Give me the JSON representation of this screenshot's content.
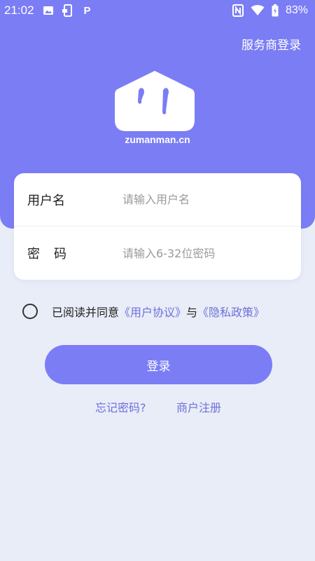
{
  "status_bar": {
    "time": "21:02",
    "battery_percent": "83%",
    "icons": [
      "image-icon",
      "screenshot-icon",
      "p-app-icon",
      "nfc-icon",
      "wifi-icon",
      "battery-icon"
    ],
    "p_label": "P"
  },
  "header": {
    "provider_login": "服务商登录",
    "domain": "zumanman.cn"
  },
  "form": {
    "username": {
      "label": "用户名",
      "value": "",
      "placeholder": "请输入用户名"
    },
    "password": {
      "label": "密码",
      "value": "",
      "placeholder": "请输入6-32位密码"
    }
  },
  "agreement": {
    "checked": false,
    "prefix": "已阅读并同意",
    "user_agreement": "《用户协议》",
    "conjunction": "与",
    "privacy_policy": "《隐私政策》"
  },
  "login_button": "登录",
  "links": {
    "forgot_password": "忘记密码?",
    "merchant_register": "商户注册"
  },
  "colors": {
    "brand": "#7b7df5",
    "link": "#6e70d9",
    "page_bg": "#e9edf8",
    "card_bg": "#ffffff"
  }
}
